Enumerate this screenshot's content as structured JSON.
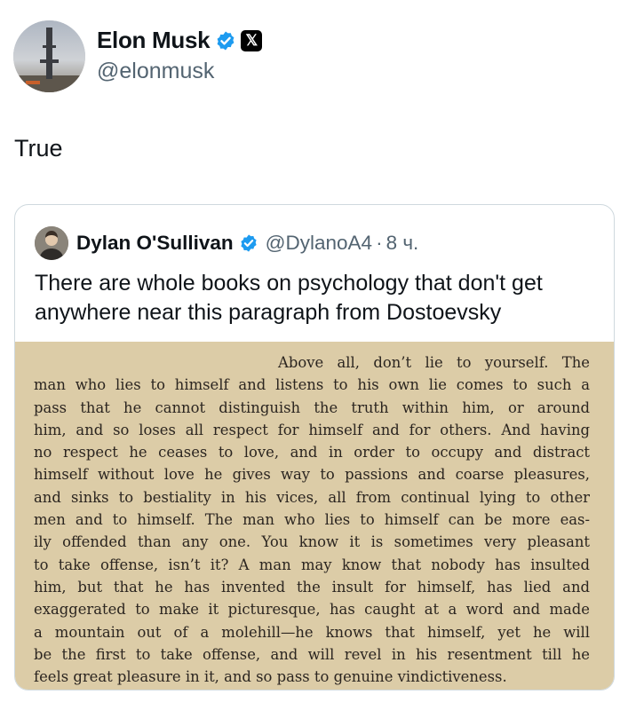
{
  "author": {
    "name": "Elon Musk",
    "handle": "@elonmusk",
    "badge_x": "𝕏"
  },
  "tweet_text": "True",
  "quoted": {
    "name": "Dylan O'Sullivan",
    "handle": "@DylanoA4",
    "separator": "·",
    "time": "8 ч.",
    "text": "There are whole books on psychology that don't get anywhere near this paragraph from Dostoevsky",
    "excerpt_lines": [
      "Above all, don’t lie to yourself.  The",
      "man who lies to himself and listens to his own lie comes to such a",
      "pass that he cannot distinguish the truth within him, or around",
      "him, and so loses all respect for himself and for others.  And having",
      "no respect he ceases to love, and in order to occupy and distract",
      "himself without love he gives way to passions and coarse pleasures,",
      "and sinks to bestiality in his vices, all from continual lying to other",
      "men and to himself.  The man who lies to himself can be more eas-",
      "ily offended than any one.  You know it is sometimes very pleasant",
      "to take offense, isn’t it?  A man may know that nobody has insulted",
      "him, but that he has invented the insult for himself, has lied and",
      "exaggerated to make it picturesque, has caught at a word and made",
      "a mountain out of a molehill—he knows that himself, yet he will",
      "be the first to take offense, and will revel in his resentment till he",
      "feels great pleasure in it, and so pass to genuine vindictiveness."
    ]
  },
  "colors": {
    "verified": "#1d9bf0",
    "handle_gray": "#536471",
    "paper": "#dccca7",
    "ink": "#2b2520"
  },
  "icons": {
    "verified": "verified-badge-icon",
    "x_logo": "x-logo-icon"
  }
}
